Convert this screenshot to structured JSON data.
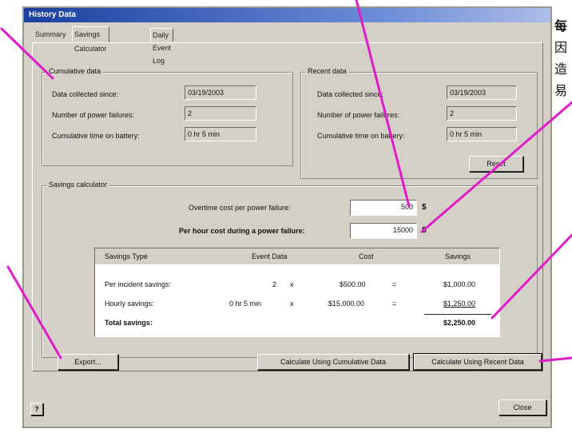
{
  "window": {
    "title": "History Data"
  },
  "tabs": [
    {
      "label": "Summary"
    },
    {
      "label": "Savings Calculator"
    },
    {
      "label": "Daily Event Log"
    }
  ],
  "cumulative": {
    "title": "Cumulative data",
    "rows": [
      {
        "label": "Data collected since:",
        "value": "03/19/2003"
      },
      {
        "label": "Number of power failures:",
        "value": "2"
      },
      {
        "label": "Cumulative time on battery:",
        "value": "0 hr 5 min"
      }
    ]
  },
  "recent": {
    "title": "Recent data",
    "rows": [
      {
        "label": "Data collected since:",
        "value": "03/19/2003"
      },
      {
        "label": "Number of power failures:",
        "value": "2"
      },
      {
        "label": "Cumulative time on battery:",
        "value": "0 hr 5 min"
      }
    ],
    "reset_label": "Reset"
  },
  "savings": {
    "title": "Savings calculator",
    "overtime_label": "Overtime cost per power failure:",
    "overtime_value": "500",
    "perhour_label": "Per hour cost during a power failure:",
    "perhour_value": "15000",
    "currency": "$"
  },
  "table": {
    "headers": [
      "Savings Type",
      "Event Data",
      "Cost",
      "Savings"
    ],
    "rows": [
      {
        "type": "Per incident savings:",
        "event": "2",
        "op1": "x",
        "cost": "$500.00",
        "op2": "=",
        "savings": "$1,000.00"
      },
      {
        "type": "Hourly savings:",
        "event": "0 hr 5 min",
        "op1": "x",
        "cost": "$15,000.00",
        "op2": "=",
        "savings": "$1,250.00"
      }
    ],
    "total_label": "Total savings:",
    "total_value": "$2,250.00"
  },
  "buttons": {
    "export": "Export...",
    "calc_cumulative": "Calculate Using Cumulative Data",
    "calc_recent": "Calculate Using Recent Data",
    "close": "Close",
    "help": "?"
  },
  "side_text": [
    "每",
    "因",
    "造",
    "易"
  ],
  "colors": {
    "titlebar": "#1a3fa0",
    "callout": "#e01cc8",
    "dialog": "#d4d0c8"
  }
}
